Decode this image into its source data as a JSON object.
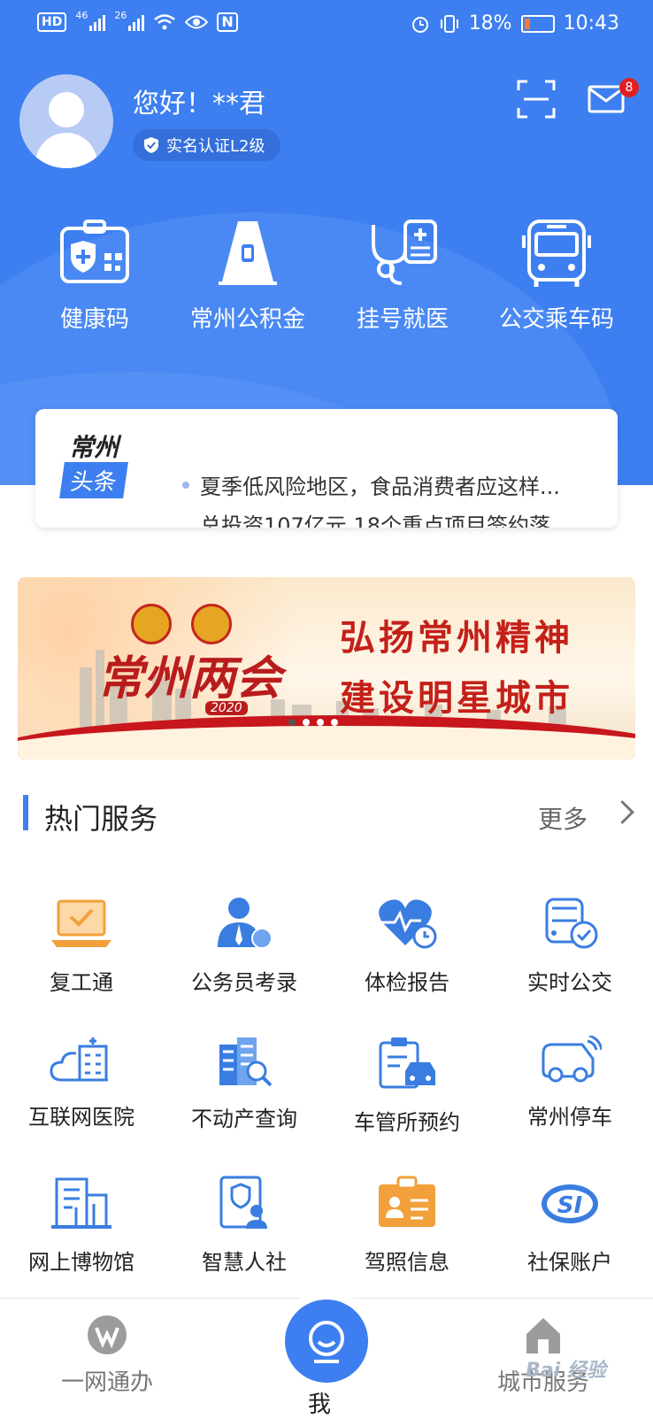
{
  "status_bar": {
    "hd": "HD",
    "net1": "46",
    "net2": "26",
    "battery": "18%",
    "time": "10:43"
  },
  "profile": {
    "greeting": "您好！**君",
    "verification": "实名认证L2级",
    "unread_count": "8"
  },
  "quick_actions": [
    {
      "label": "健康码",
      "icon": "health-code-icon"
    },
    {
      "label": "常州公积金",
      "icon": "housing-fund-icon"
    },
    {
      "label": "挂号就医",
      "icon": "stethoscope-icon"
    },
    {
      "label": "公交乘车码",
      "icon": "bus-icon"
    }
  ],
  "news": {
    "brand_top": "常州",
    "brand_bottom": "头条",
    "headline": "夏季低风险地区，食品消费者应这样...",
    "next_headline": "总投资107亿元 18个重点项目签约落"
  },
  "banner": {
    "emblem_text": "",
    "logo": "常州两会",
    "year": "2020",
    "slogan1": "弘扬常州精神",
    "slogan2": "建设明星城市",
    "active_slide": 1,
    "slide_count": 4
  },
  "hot_services": {
    "title": "热门服务",
    "more": "更多",
    "items": [
      {
        "label": "复工通",
        "icon": "laptop-check-icon",
        "color": "#f2a03b"
      },
      {
        "label": "公务员考录",
        "icon": "civil-servant-icon",
        "color": "#3a7de0"
      },
      {
        "label": "体检报告",
        "icon": "heart-clock-icon",
        "color": "#3a7de0"
      },
      {
        "label": "实时公交",
        "icon": "bus-realtime-icon",
        "color": "#3a7de0"
      },
      {
        "label": "互联网医院",
        "icon": "cloud-hospital-icon",
        "color": "#3a7de0"
      },
      {
        "label": "不动产查询",
        "icon": "building-search-icon",
        "color": "#3a7de0"
      },
      {
        "label": "车管所预约",
        "icon": "clipboard-car-icon",
        "color": "#3a7de0"
      },
      {
        "label": "常州停车",
        "icon": "parking-car-icon",
        "color": "#3a7de0"
      },
      {
        "label": "网上博物馆",
        "icon": "museum-icon",
        "color": "#3a7de0"
      },
      {
        "label": "智慧人社",
        "icon": "social-insurance-icon",
        "color": "#3a7de0"
      },
      {
        "label": "驾照信息",
        "icon": "license-card-icon",
        "color": "#f2a03b"
      },
      {
        "label": "社保账户",
        "icon": "si-logo-icon",
        "color": "#3a7de0"
      }
    ]
  },
  "tabbar": {
    "tab1": "一网通办",
    "tab2": "我",
    "tab3": "城市服务"
  },
  "watermark": "Bai 经验",
  "colors": {
    "primary": "#3d7ff0",
    "accent_orange": "#f2a03b",
    "badge_red": "#e02020"
  }
}
